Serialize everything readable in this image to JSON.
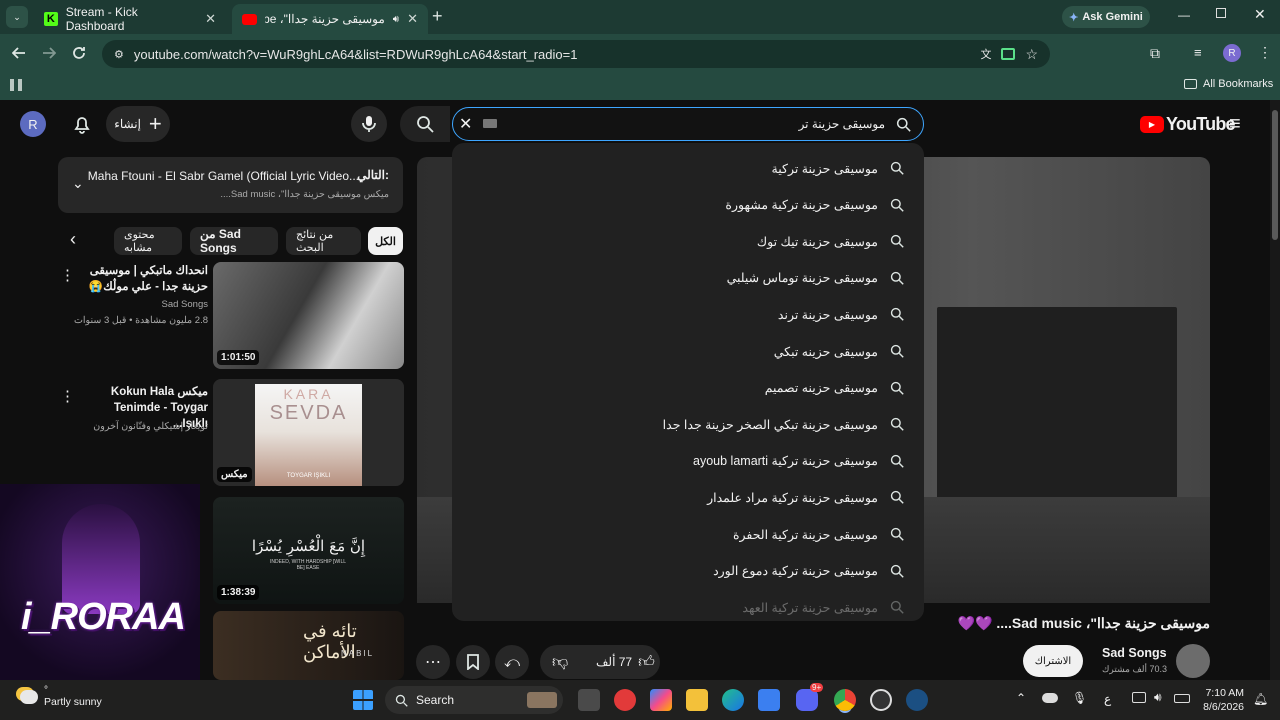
{
  "browser": {
    "tabs": [
      {
        "title": "Stream - Kick Dashboard"
      },
      {
        "title": "موسيقى حزينة جداا\"، ouTube"
      }
    ],
    "ask_gemini": "Ask Gemini",
    "url": "youtube.com/watch?v=WuR9ghLcA64&list=RDWuR9ghLcA64&start_radio=1",
    "profile_initial": "R",
    "all_bookmarks": "All Bookmarks"
  },
  "youtube": {
    "avatar_initial": "R",
    "create_label": "إنشاء",
    "search_value": "موسيقى حزينة تر",
    "logo_text": "YouTube",
    "suggestions": [
      "موسيقى حزينة تركية",
      "موسيقى حزينة تركية مشهورة",
      "موسيقى حزينة تيك توك",
      "موسيقى حزينة توماس شيلبي",
      "موسيقى حزينة ترند",
      "موسيقى حزينه تبكي",
      "موسيقى حزينه تصميم",
      "موسيقى حزينة تبكي الصخر حزينة جدا جدا",
      "موسيقى حزينة تركية ayoub lamarti",
      "موسيقى حزينة تركية مراد علمدار",
      "موسيقى حزينة تركية الحفرة",
      "موسيقى حزينة تركية دموع الورد",
      "موسيقى حزينة تركية العهد"
    ],
    "up_next_label": "التالي:",
    "up_next_title": "Maha Ftouni - El Sabr Gamel (Official Lyric Video...",
    "up_next_sub": "ميكس موسيقى حزينة جداا\"، Sad music....",
    "chips": [
      "الكل",
      "من نتائج البحث",
      "من Sad Songs",
      "محتوى مشابه"
    ],
    "videos": [
      {
        "title": "انحداك ماتبكي | موسيقى حزينة جدا - علي موڷك😭",
        "channel": "Sad Songs",
        "meta": "2.8 مليون مشاهدة • قبل 3 سنوات",
        "duration": "1:01:50"
      },
      {
        "title": "ميكس Kokun Hala Tenimde - Toygar Işıklı...",
        "channel": "تويغار إشيكلي وفنّانون آخرون",
        "meta": "",
        "duration": "ميكس"
      },
      {
        "title": "",
        "channel": "",
        "meta": "",
        "duration": "1:38:39"
      },
      {
        "title": "",
        "channel": "",
        "meta": "",
        "duration": ""
      }
    ],
    "thumb_texts": {
      "kara": "KARA",
      "sevda": "SEVDA",
      "singer": "TOYGAR IŞIKLI",
      "quran": "إِنَّ مَعَ الْعُسْرِ يُسْرًا",
      "quran_en": "INDEED, WITH HARDSHIP [WILL BE] EASE",
      "nabil_title": "تائه في الأماكن",
      "nabil": "NABIL"
    },
    "video_title": "موسيقى حزينة جداا\"، Sad music.... 💜💜",
    "channel_name": "Sad Songs",
    "subscribers": "70.3 ألف مشترك",
    "subscribe_label": "الاشتراك",
    "likes": "77 ألف",
    "overlay_logo": "i_RORAA"
  },
  "taskbar": {
    "weather_temp": "°",
    "weather_text": "Partly sunny",
    "search_label": "Search",
    "lang": "ع",
    "time": "7:10 AM",
    "date": "8/6/2026",
    "discord_badge": "9+"
  },
  "colors": {
    "accent": "#3ea6ff",
    "chrome": "#254a40",
    "youtube_red": "#ff0000"
  }
}
